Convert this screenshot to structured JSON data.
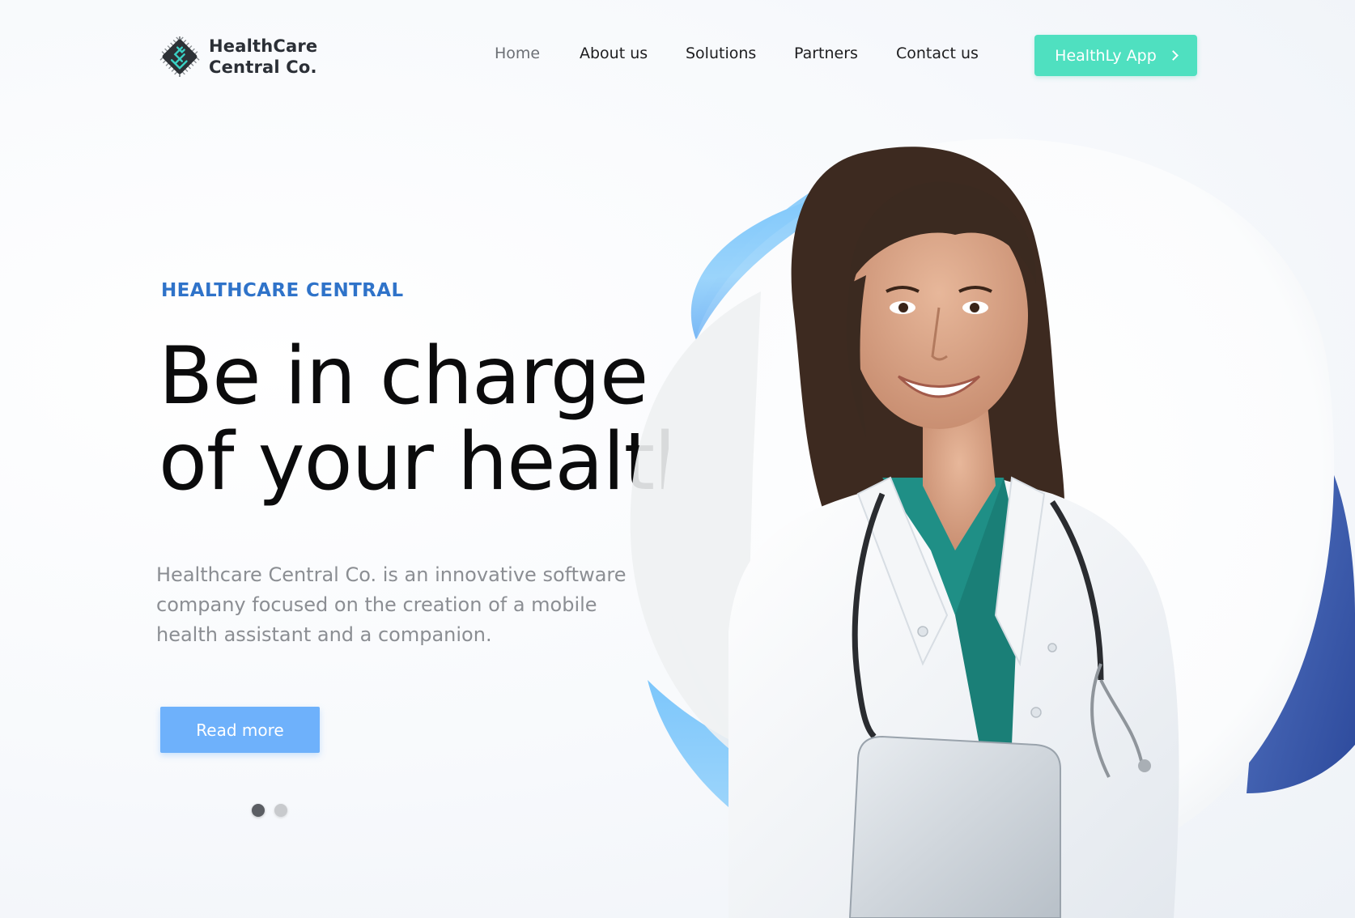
{
  "brand": {
    "name_line1": "HealthCare",
    "name_line2": "Central Co.",
    "logo_icon": "circuit-chip-logo-icon"
  },
  "nav": {
    "items": [
      {
        "label": "Home",
        "active": true
      },
      {
        "label": "About us",
        "active": false
      },
      {
        "label": "Solutions",
        "active": false
      },
      {
        "label": "Partners",
        "active": false
      },
      {
        "label": "Contact us",
        "active": false
      }
    ],
    "cta_label": "HealthLy App",
    "cta_icon": "chevron-right-icon"
  },
  "hero": {
    "eyebrow": "HEALTHCARE CENTRAL",
    "headline_line1": "Be in charge",
    "headline_line2": "of your health",
    "description": "Healthcare Central Co. is an innovative software company focused on the creation of a mobile health assistant and a companion.",
    "read_more_label": "Read more",
    "slides": {
      "total": 2,
      "current": 1
    },
    "image": "smiling-doctor-with-stethoscope-and-tablet"
  },
  "colors": {
    "accent_teal": "#4fe0c0",
    "accent_blue": "#2f73c9",
    "button_blue": "#6eb1fb",
    "blob_light_blue": "#8fd0fb",
    "blob_dark_blue": "#3c5aa8",
    "scrub_teal": "#1f8f86"
  }
}
